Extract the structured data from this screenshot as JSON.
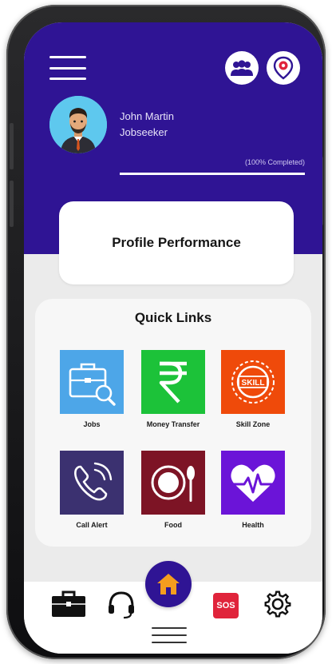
{
  "header": {
    "user_name": "John Martin",
    "user_role": "Jobseeker",
    "progress_label": "(100% Completed)",
    "progress_fraction": 1.0
  },
  "profile": {
    "title": "Profile Performance"
  },
  "quick_links": {
    "title": "Quick Links",
    "items": [
      {
        "label": "Jobs",
        "icon": "briefcase-search-icon",
        "color": "#4da6e8"
      },
      {
        "label": "Money Transfer",
        "icon": "rupee-icon",
        "color": "#1cc239"
      },
      {
        "label": "Skill Zone",
        "icon": "skill-badge-icon",
        "color": "#ef4a0a"
      },
      {
        "label": "Call Alert",
        "icon": "phone-call-icon",
        "color": "#3b3170"
      },
      {
        "label": "Food",
        "icon": "plate-spoon-icon",
        "color": "#7d1425"
      },
      {
        "label": "Health",
        "icon": "heart-pulse-icon",
        "color": "#6b14d8"
      }
    ]
  },
  "bottom_nav": {
    "items": [
      "briefcase-icon",
      "headset-icon",
      "home-icon",
      "sos-icon",
      "settings-gear-icon"
    ],
    "sos_label": "SOS"
  },
  "colors": {
    "header_bg": "#2f1494",
    "home_button": "#2f1494",
    "home_icon": "#f59d1e",
    "sos": "#e0243b"
  }
}
